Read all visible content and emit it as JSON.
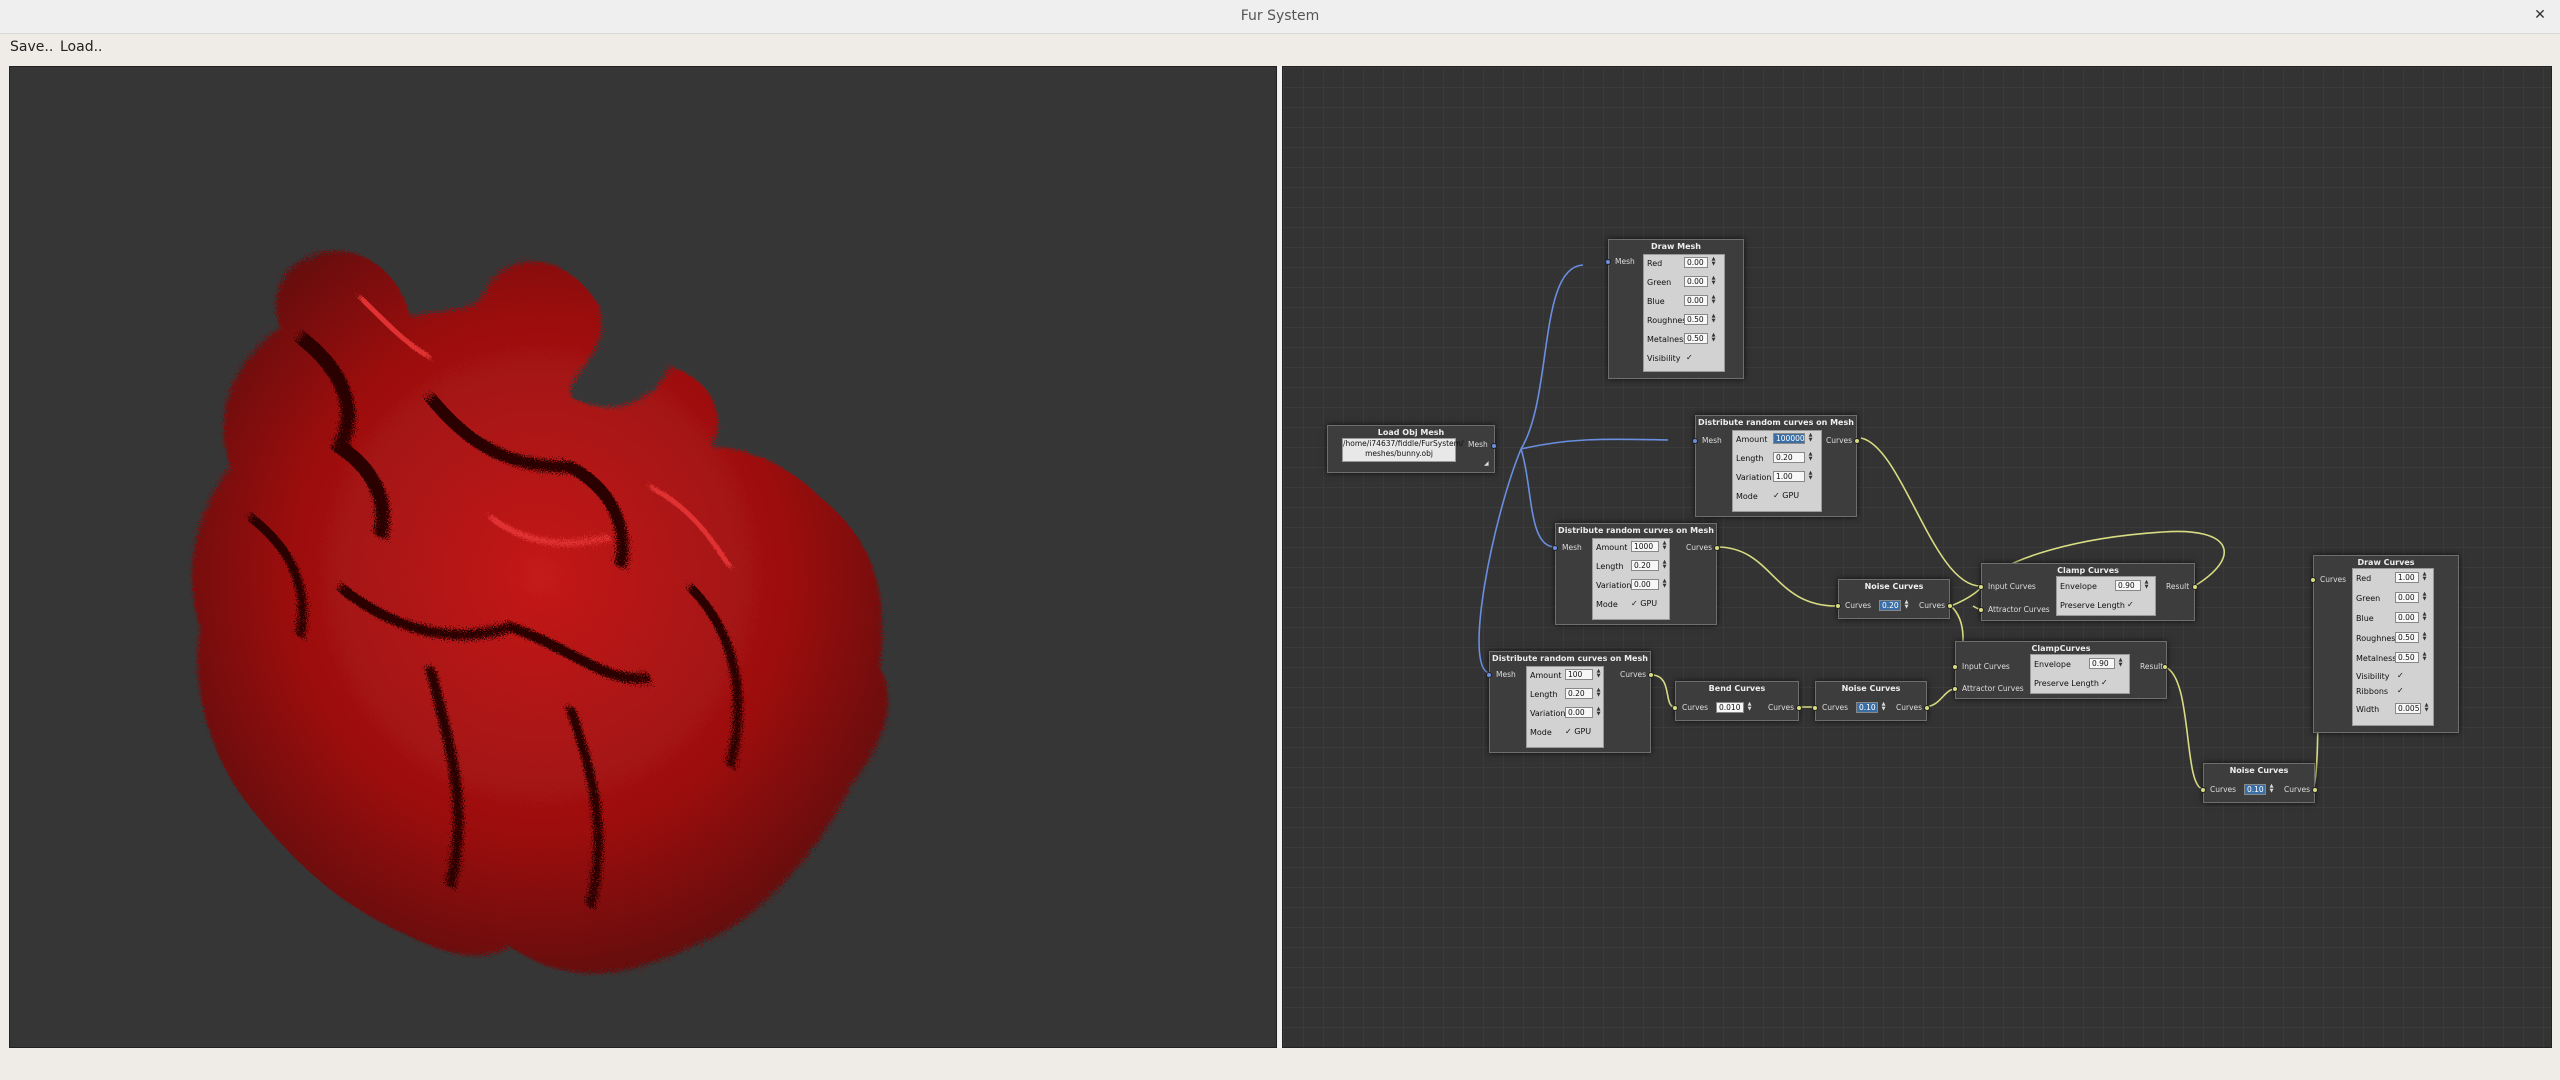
{
  "window": {
    "title": "Fur System"
  },
  "menu": {
    "save": "Save..",
    "load": "Load.."
  },
  "nodes": {
    "draw_mesh": {
      "title": "Draw Mesh",
      "in_port": "Mesh",
      "rows": [
        {
          "label": "Red",
          "value": "0.00"
        },
        {
          "label": "Green",
          "value": "0.00"
        },
        {
          "label": "Blue",
          "value": "0.00"
        },
        {
          "label": "Roughness",
          "value": "0.50"
        },
        {
          "label": "Metalness",
          "value": "0.50"
        }
      ],
      "visibility_label": "Visibility",
      "visibility": "✓"
    },
    "load_obj": {
      "title": "Load Obj Mesh",
      "path_line1": "/home/i74637/fiddle/FurSystem/",
      "path_line2": "meshes/bunny.obj",
      "out_port": "Mesh",
      "resize_mark": "◢"
    },
    "dist1": {
      "title": "Distribute random curves on Mesh",
      "in_port": "Mesh",
      "out_port": "Curves",
      "amount_label": "Amount",
      "amount": "100000",
      "length_label": "Length",
      "length": "0.20",
      "variation_label": "Variation",
      "variation": "1.00",
      "mode_label": "Mode",
      "mode": "✓ GPU"
    },
    "dist2": {
      "title": "Distribute random curves on Mesh",
      "in_port": "Mesh",
      "out_port": "Curves",
      "amount_label": "Amount",
      "amount": "1000",
      "length_label": "Length",
      "length": "0.20",
      "variation_label": "Variation",
      "variation": "0.00",
      "mode_label": "Mode",
      "mode": "✓ GPU"
    },
    "dist3": {
      "title": "Distribute random curves on Mesh",
      "in_port": "Mesh",
      "out_port": "Curves",
      "amount_label": "Amount",
      "amount": "100",
      "length_label": "Length",
      "length": "0.20",
      "variation_label": "Variation",
      "variation": "0.00",
      "mode_label": "Mode",
      "mode": "✓ GPU"
    },
    "noise1": {
      "title": "Noise Curves",
      "in_port": "Curves",
      "out_port": "Curves",
      "value": "0.20"
    },
    "noise2": {
      "title": "Noise Curves",
      "in_port": "Curves",
      "out_port": "Curves",
      "value": "0.10"
    },
    "noise3": {
      "title": "Noise Curves",
      "in_port": "Curves",
      "out_port": "Curves",
      "value": "0.10"
    },
    "bend": {
      "title": "Bend Curves",
      "in_port": "Curves",
      "out_port": "Curves",
      "value": "0.010"
    },
    "clamp1": {
      "title": "Clamp Curves",
      "in1": "Input Curves",
      "in2": "Attractor Curves",
      "out_port": "Result",
      "envelope_label": "Envelope",
      "envelope": "0.90",
      "preserve_label": "Preserve Length",
      "preserve": "✓"
    },
    "clamp2": {
      "title": "ClampCurves",
      "in1": "Input Curves",
      "in2": "Attractor Curves",
      "out_port": "Result",
      "envelope_label": "Envelope",
      "envelope": "0.90",
      "preserve_label": "Preserve Length",
      "preserve": "✓"
    },
    "draw_curves": {
      "title": "Draw Curves",
      "in_port": "Curves",
      "rows": [
        {
          "label": "Red",
          "value": "1.00"
        },
        {
          "label": "Green",
          "value": "0.00"
        },
        {
          "label": "Blue",
          "value": "0.00"
        },
        {
          "label": "Roughness",
          "value": "0.50"
        },
        {
          "label": "Metalness",
          "value": "0.50"
        }
      ],
      "visibility_label": "Visibility",
      "visibility": "✓",
      "ribbons_label": "Ribbons",
      "ribbons": "✓",
      "width_label": "Width",
      "width": "0.005"
    }
  },
  "colors": {
    "mesh_wire": "#6a8ee0",
    "curve_wire": "#d8dc82",
    "fur": "#a01212",
    "viewport_bg": "#363636"
  }
}
